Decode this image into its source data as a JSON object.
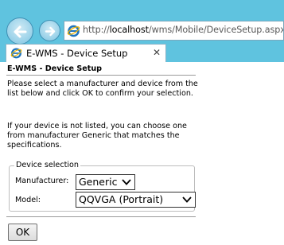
{
  "browser": {
    "address": {
      "prefix": "http://",
      "host": "localhost",
      "path": "/wms/Mobile/DeviceSetup.aspx"
    },
    "tab": {
      "title": "E-WMS - Device Setup",
      "close_glyph": "✕"
    },
    "icons": {
      "back": "back-arrow-icon",
      "forward": "forward-arrow-icon",
      "page": "internet-explorer-icon",
      "close": "close-icon"
    },
    "colors": {
      "frame": "#5fc3df",
      "nav_button": "#9fd4ea",
      "ie_logo": "#1e73be"
    }
  },
  "page": {
    "title": "E-WMS - Device Setup",
    "instructions": "Please select a manufacturer and device from the list below and click OK to confirm your selection.",
    "help_text": "If your device is not listed, you can choose one from manufacturer Generic that matches the specifications.",
    "device_selection": {
      "legend": "Device selection",
      "manufacturer_label": "Manufacturer:",
      "manufacturer_value": "Generic",
      "model_label": "Model:",
      "model_value": "QQVGA (Portrait)"
    },
    "ok_label": "OK"
  }
}
